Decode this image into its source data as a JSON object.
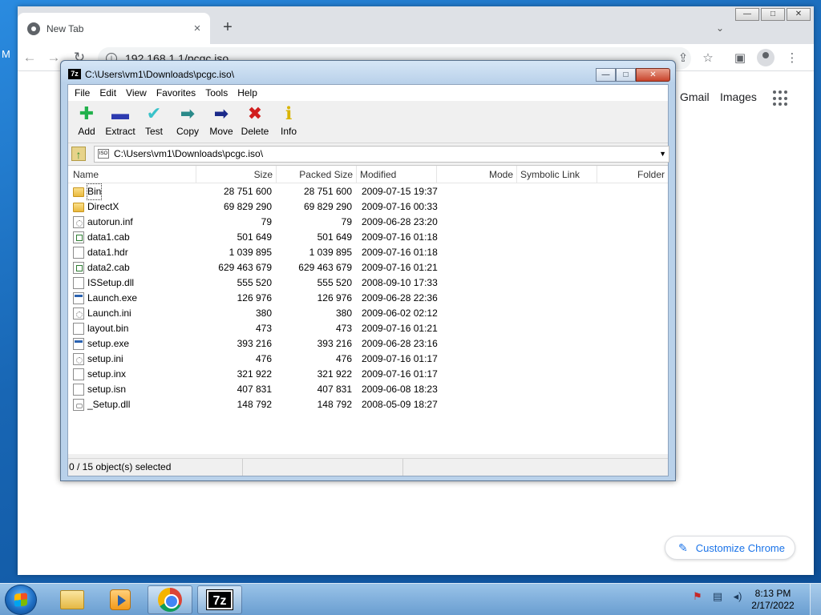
{
  "desktop": {
    "edge_text": "M"
  },
  "chrome": {
    "tab_title": "New Tab",
    "tab_close": "×",
    "new_tab": "+",
    "url": "192.168.1.1/pcgc.iso",
    "ntp": {
      "gmail": "Gmail",
      "images": "Images",
      "customize": "Customize Chrome"
    },
    "window_controls": {
      "minimize": "—",
      "maximize": "□",
      "close": "✕"
    }
  },
  "sevenzip": {
    "title": "C:\\Users\\vm1\\Downloads\\pcgc.iso\\",
    "menu": [
      "File",
      "Edit",
      "View",
      "Favorites",
      "Tools",
      "Help"
    ],
    "toolbar": [
      {
        "label": "Add",
        "glyph": "✚",
        "color": "#22b14c"
      },
      {
        "label": "Extract",
        "glyph": "▬",
        "color": "#2d3bb0"
      },
      {
        "label": "Test",
        "glyph": "✔",
        "color": "#39c2c9"
      },
      {
        "label": "Copy",
        "glyph": "➡",
        "color": "#2a8a8a"
      },
      {
        "label": "Move",
        "glyph": "➡",
        "color": "#1b2a8a"
      },
      {
        "label": "Delete",
        "glyph": "✖",
        "color": "#d11f1f"
      },
      {
        "label": "Info",
        "glyph": "ℹ",
        "color": "#d9b400"
      }
    ],
    "address": "C:\\Users\\vm1\\Downloads\\pcgc.iso\\",
    "columns": [
      "Name",
      "Size",
      "Packed Size",
      "Modified",
      "Mode",
      "Symbolic Link",
      "Folder"
    ],
    "files": [
      {
        "name": "Bin",
        "size": "28 751 600",
        "packed": "28 751 600",
        "modified": "2009-07-15 19:37",
        "kind": "folder"
      },
      {
        "name": "DirectX",
        "size": "69 829 290",
        "packed": "69 829 290",
        "modified": "2009-07-16 00:33",
        "kind": "folder"
      },
      {
        "name": "autorun.inf",
        "size": "79",
        "packed": "79",
        "modified": "2009-06-28 23:20",
        "kind": "cfg"
      },
      {
        "name": "data1.cab",
        "size": "501 649",
        "packed": "501 649",
        "modified": "2009-07-16 01:18",
        "kind": "cab"
      },
      {
        "name": "data1.hdr",
        "size": "1 039 895",
        "packed": "1 039 895",
        "modified": "2009-07-16 01:18",
        "kind": "file"
      },
      {
        "name": "data2.cab",
        "size": "629 463 679",
        "packed": "629 463 679",
        "modified": "2009-07-16 01:21",
        "kind": "cab"
      },
      {
        "name": "ISSetup.dll",
        "size": "555 520",
        "packed": "555 520",
        "modified": "2008-09-10 17:33",
        "kind": "file"
      },
      {
        "name": "Launch.exe",
        "size": "126 976",
        "packed": "126 976",
        "modified": "2009-06-28 22:36",
        "kind": "exe"
      },
      {
        "name": "Launch.ini",
        "size": "380",
        "packed": "380",
        "modified": "2009-06-02 02:12",
        "kind": "cfg"
      },
      {
        "name": "layout.bin",
        "size": "473",
        "packed": "473",
        "modified": "2009-07-16 01:21",
        "kind": "file"
      },
      {
        "name": "setup.exe",
        "size": "393 216",
        "packed": "393 216",
        "modified": "2009-06-28 23:16",
        "kind": "exe"
      },
      {
        "name": "setup.ini",
        "size": "476",
        "packed": "476",
        "modified": "2009-07-16 01:17",
        "kind": "cfg"
      },
      {
        "name": "setup.inx",
        "size": "321 922",
        "packed": "321 922",
        "modified": "2009-07-16 01:17",
        "kind": "file"
      },
      {
        "name": "setup.isn",
        "size": "407 831",
        "packed": "407 831",
        "modified": "2009-06-08 18:23",
        "kind": "file"
      },
      {
        "name": "_Setup.dll",
        "size": "148 792",
        "packed": "148 792",
        "modified": "2008-05-09 18:27",
        "kind": "dll"
      }
    ],
    "status": "0 / 15 object(s) selected",
    "window_controls": {
      "minimize": "—",
      "maximize": "□",
      "close": "✕"
    }
  },
  "taskbar": {
    "time": "8:13 PM",
    "date": "2/17/2022",
    "seven_zip_label": "7z",
    "apps": [
      "windows-explorer",
      "media-player",
      "chrome",
      "7-zip"
    ],
    "tray_icons": [
      "action-center-flag",
      "network",
      "volume"
    ]
  },
  "colors": {
    "chrome_accent": "#1a73e8",
    "taskbar": "#7ab0dc",
    "desktop": "#1866b4"
  }
}
